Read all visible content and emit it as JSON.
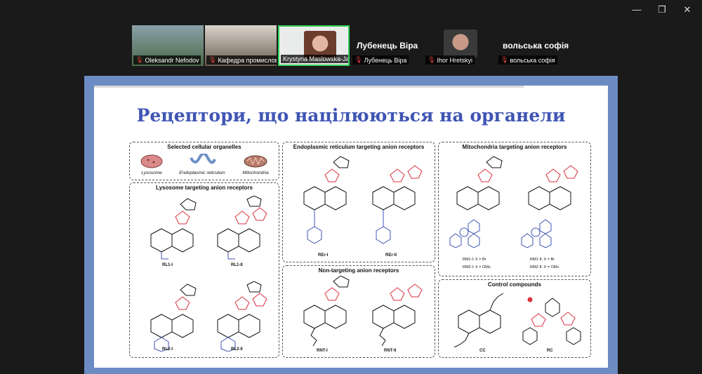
{
  "window": {
    "minimize": "—",
    "restore": "❐",
    "close": "✕"
  },
  "participants": [
    {
      "name": "Oleksandr Nefodov"
    },
    {
      "name": "Кафедра промислової фа..."
    },
    {
      "name": "Krystyna Maslowska-Jarzy..."
    },
    {
      "name": "Лубенець Віра",
      "display": "Лубенець Віра"
    },
    {
      "name": "Ihor Hretskyi"
    },
    {
      "name": "вольська софія",
      "display": "вольська софія"
    }
  ],
  "slide": {
    "title": "Рецептори, що націлюються на органели",
    "panels": {
      "organelles": {
        "title": "Selected cellular organelles",
        "items": [
          "Lysosome",
          "Endoplasmic reticulum",
          "Mitochondria"
        ]
      },
      "lysosome": {
        "title": "Lysosome targeting anion receptors",
        "labels": [
          "RL1-I",
          "RL1-II",
          "RL2-I",
          "RL2-II"
        ]
      },
      "er": {
        "title": "Endoplasmic reticulum targeting anion receptors",
        "labels": [
          "REr-I",
          "REr-II"
        ]
      },
      "mito": {
        "title": "Mitochondria targeting anion receptors",
        "notes": [
          "RM1-I: X = Br",
          "RM2-I: X = OMs",
          "RM1-II: X = Br",
          "RM2-II: X = OMs"
        ]
      },
      "nontarget": {
        "title": "Non-targeting anion receptors",
        "labels": [
          "RNT-I",
          "RNT-II"
        ]
      },
      "control": {
        "title": "Control compounds",
        "labels": [
          "CC",
          "RC"
        ]
      }
    }
  }
}
